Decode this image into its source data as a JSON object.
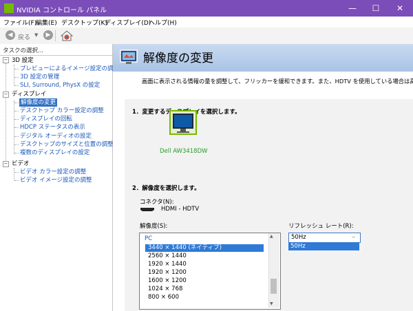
{
  "window": {
    "title": "NVIDIA コントロール パネル",
    "min": "—",
    "max": "☐",
    "close": "✕"
  },
  "menu": [
    "ファイル(F)",
    "編集(E)",
    "デスクトップ(K)",
    "ディスプレイ(D)",
    "ヘルプ(H)"
  ],
  "toolbar": {
    "back_label": "戻る"
  },
  "tree": {
    "header": "タスクの選択...",
    "categories": [
      {
        "label": "3D 設定",
        "items": [
          "プレビューによるイメージ設定の調整",
          "3D 設定の管理",
          "SLI, Surround, PhysX の設定"
        ]
      },
      {
        "label": "ディスプレイ",
        "items": [
          "解像度の変更",
          "デスクトップ カラー設定の調整",
          "ディスプレイの回転",
          "HDCP ステータスの表示",
          "デジタル オーディオの設定",
          "デスクトップのサイズと位置の調整",
          "複数のディスプレイの設定"
        ]
      },
      {
        "label": "ビデオ",
        "items": [
          "ビデオ カラー設定の調整",
          "ビデオ イメージ設定の調整"
        ]
      }
    ],
    "selected": "解像度の変更"
  },
  "page": {
    "title": "解像度の変更",
    "description": "画面に表示される情報の量を調整して、フリッカーを緩和できます。また、HDTV を使用している場合は高精",
    "step1": "1．変更するディスプレイを選択します。",
    "display_name": "Dell AW3418DW",
    "step2": "2．解像度を選択します。",
    "connector_label": "コネクタ(N):",
    "connector_value": "HDMI - HDTV",
    "resolution_label": "解像度(S):",
    "refresh_label": "リフレッシュ レート(R):",
    "resolution_group": "PC",
    "resolutions": [
      "3440 × 1440 (ネイティブ)",
      "2560 × 1440",
      "1920 × 1440",
      "1920 × 1200",
      "1600 × 1200",
      "1024 × 768",
      "800 × 600"
    ],
    "selected_resolution": "3440 × 1440 (ネイティブ)",
    "refresh_value": "50Hz",
    "refresh_options": [
      "50Hz"
    ]
  },
  "colors": {
    "titlebar": "#7b4db8",
    "nvidia_green": "#76b900",
    "selection_blue": "#2e7ad6",
    "link_blue": "#1a57b8",
    "display_green": "#2a9a2a"
  },
  "icons": [
    "nvidia-logo-icon",
    "back-arrow-icon",
    "forward-arrow-icon",
    "home-icon",
    "display-monitor-icon",
    "hdmi-connector-icon",
    "resolution-page-icon"
  ]
}
